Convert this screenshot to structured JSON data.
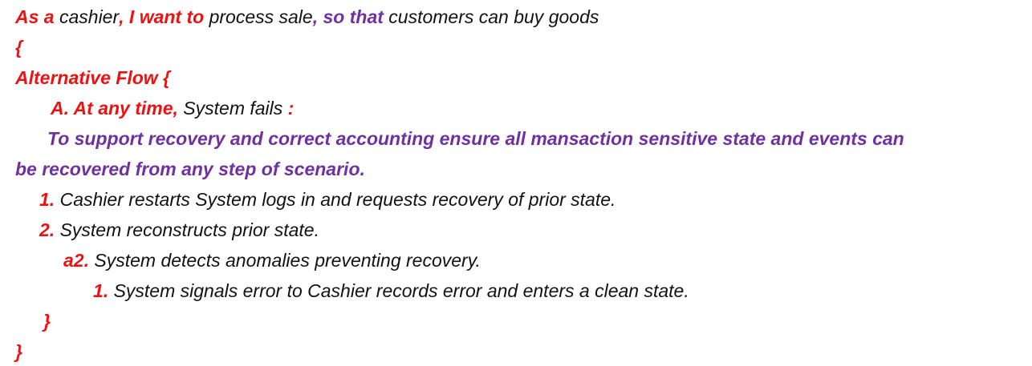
{
  "colors": {
    "keyword_red": "#ee1111",
    "keyword_purple": "#7030a0",
    "text": "#111111"
  },
  "story": {
    "as_a": "As a",
    "role": " cashier",
    "i_want_to": ", I want to",
    "goal": " process sale",
    "so_that": ", so that",
    "benefit": " customers can buy goods"
  },
  "open_brace": "{",
  "alt_flow": {
    "header": "Alternative Flow {",
    "condition_label": "A. At any time,",
    "condition_text": " System fails",
    "condition_colon": " :",
    "requirement_line1": "To support recovery and correct accounting ensure all mansaction sensitive state and events can",
    "requirement_line2": "be recovered from any step of scenario.",
    "steps": [
      {
        "num": "1.",
        "text": " Cashier restarts System logs in and requests recovery of prior state."
      },
      {
        "num": "2.",
        "text": " System reconstructs prior state."
      },
      {
        "num": "a2.",
        "text": " System detects anomalies preventing recovery."
      },
      {
        "num": "1.",
        "text": " System signals error to Cashier records error and enters a clean state."
      }
    ],
    "close_brace": "}"
  },
  "close_brace": "}"
}
